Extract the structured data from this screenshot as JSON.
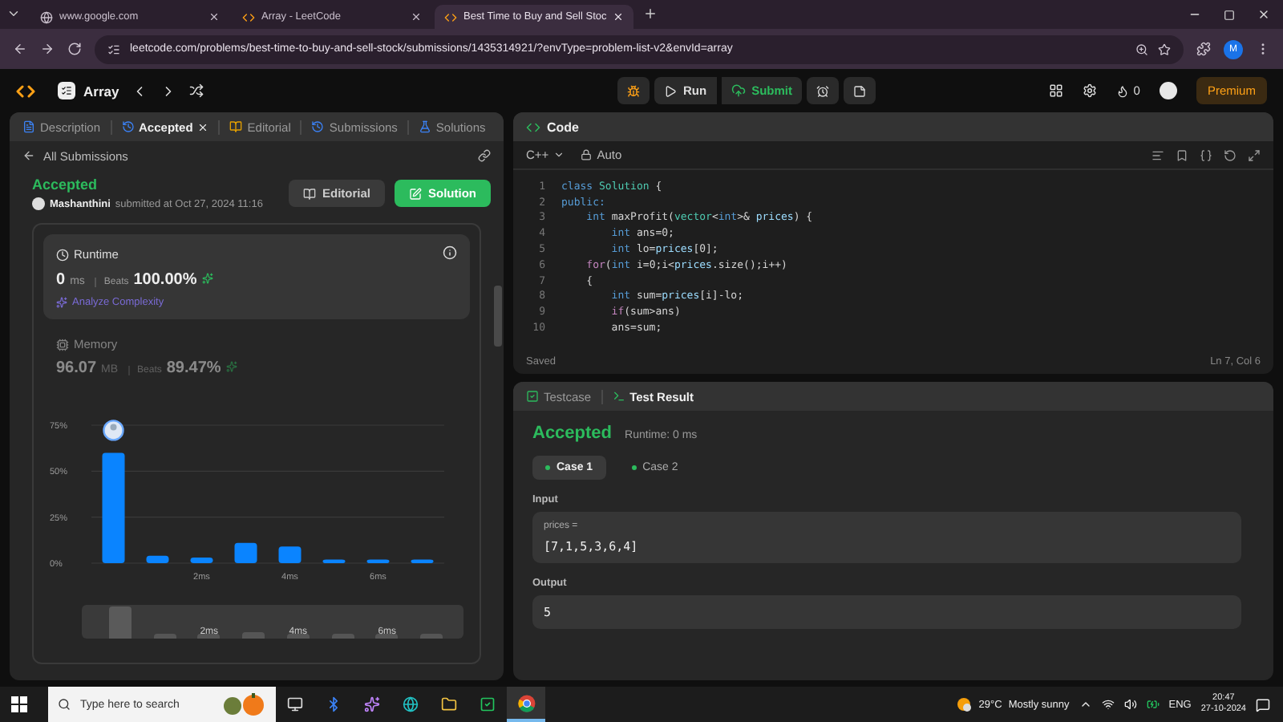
{
  "browser": {
    "tabs": [
      {
        "title": "www.google.com",
        "selected": false
      },
      {
        "title": "Array - LeetCode",
        "selected": false
      },
      {
        "title": "Best Time to Buy and Sell Stoc",
        "selected": true
      }
    ],
    "url": "leetcode.com/problems/best-time-to-buy-and-sell-stock/submissions/1435314921/?envType=problem-list-v2&envId=array",
    "profile_initial": "M"
  },
  "topbar": {
    "problem_list": "Array",
    "run": "Run",
    "submit": "Submit",
    "streak": "0",
    "premium": "Premium"
  },
  "left_panel": {
    "tabs": [
      {
        "label": "Description",
        "selected": false
      },
      {
        "label": "Accepted",
        "selected": true
      },
      {
        "label": "Editorial",
        "selected": false
      },
      {
        "label": "Submissions",
        "selected": false
      },
      {
        "label": "Solutions",
        "selected": false
      }
    ],
    "back_link": "All Submissions",
    "status": "Accepted",
    "user": "Mashanthini",
    "submitted": "submitted at Oct 27, 2024 11:16",
    "buttons": {
      "editorial": "Editorial",
      "solution": "Solution"
    },
    "metrics": [
      {
        "label": "Runtime",
        "value": "0",
        "unit": "ms",
        "beats_label": "Beats",
        "beats": "100.00%",
        "link": "Analyze Complexity",
        "selected": true
      },
      {
        "label": "Memory",
        "value": "96.07",
        "unit": "MB",
        "beats_label": "Beats",
        "beats": "89.47%",
        "selected": false
      }
    ],
    "chart_data": {
      "type": "bar",
      "x": [
        0,
        1,
        2,
        3,
        4,
        5,
        6,
        7
      ],
      "values": [
        60,
        4,
        3,
        11,
        9,
        2,
        2,
        2
      ],
      "xticks": [
        {
          "value": 2,
          "label": "2ms"
        },
        {
          "value": 4,
          "label": "4ms"
        },
        {
          "value": 6,
          "label": "6ms"
        }
      ],
      "yticks": [
        {
          "value": 0,
          "label": "0%"
        },
        {
          "value": 25,
          "label": "25%"
        },
        {
          "value": 50,
          "label": "50%"
        },
        {
          "value": 75,
          "label": "75%"
        }
      ],
      "xlim": [
        -0.5,
        7.5
      ],
      "ylim": [
        0,
        75
      ]
    },
    "range_labels": [
      "2ms",
      "4ms",
      "6ms"
    ]
  },
  "code_panel": {
    "title": "Code",
    "language": "C++",
    "mode": "Auto",
    "lines": [
      {
        "num": "1",
        "tokens": [
          {
            "text": "class",
            "kind": "keyword"
          },
          {
            "text": " Solution",
            "kind": "type"
          },
          {
            "text": " {",
            "kind": "plain"
          }
        ]
      },
      {
        "num": "2",
        "tokens": [
          {
            "text": "public:",
            "kind": "keyword"
          }
        ]
      },
      {
        "num": "3",
        "tokens": [
          {
            "text": "    int",
            "kind": "keyword"
          },
          {
            "text": " maxProfit(",
            "kind": "plain"
          },
          {
            "text": "vector",
            "kind": "type"
          },
          {
            "text": "<",
            "kind": "plain"
          },
          {
            "text": "int",
            "kind": "keyword"
          },
          {
            "text": ">& ",
            "kind": "plain"
          },
          {
            "text": "prices",
            "kind": "variable"
          },
          {
            "text": ") {",
            "kind": "plain"
          }
        ]
      },
      {
        "num": "4",
        "tokens": [
          {
            "text": "        int",
            "kind": "keyword"
          },
          {
            "text": " ans=0;",
            "kind": "plain"
          }
        ]
      },
      {
        "num": "5",
        "tokens": [
          {
            "text": "        int",
            "kind": "keyword"
          },
          {
            "text": " lo=",
            "kind": "plain"
          },
          {
            "text": "prices",
            "kind": "variable"
          },
          {
            "text": "[0];",
            "kind": "plain"
          }
        ]
      },
      {
        "num": "6",
        "tokens": [
          {
            "text": "    for",
            "kind": "control"
          },
          {
            "text": "(",
            "kind": "plain"
          },
          {
            "text": "int",
            "kind": "keyword"
          },
          {
            "text": " i=0;i<",
            "kind": "plain"
          },
          {
            "text": "prices",
            "kind": "variable"
          },
          {
            "text": ".size();i++)",
            "kind": "plain"
          }
        ]
      },
      {
        "num": "7",
        "tokens": [
          {
            "text": "    {",
            "kind": "plain"
          }
        ]
      },
      {
        "num": "8",
        "tokens": [
          {
            "text": "        int",
            "kind": "keyword"
          },
          {
            "text": " sum=",
            "kind": "plain"
          },
          {
            "text": "prices",
            "kind": "variable"
          },
          {
            "text": "[i]-lo;",
            "kind": "plain"
          }
        ]
      },
      {
        "num": "9",
        "tokens": [
          {
            "text": "        if",
            "kind": "control"
          },
          {
            "text": "(sum>ans)",
            "kind": "plain"
          }
        ]
      },
      {
        "num": "10",
        "tokens": [
          {
            "text": "        ans=sum;",
            "kind": "plain"
          }
        ]
      }
    ],
    "saved": "Saved",
    "cursor": "Ln 7, Col 6"
  },
  "test_panel": {
    "tabs": [
      {
        "label": "Testcase",
        "selected": false
      },
      {
        "label": "Test Result",
        "selected": true
      }
    ],
    "status": "Accepted",
    "runtime": "Runtime: 0 ms",
    "cases": [
      {
        "label": "Case 1",
        "selected": true
      },
      {
        "label": "Case 2",
        "selected": false
      }
    ],
    "input_label": "Input",
    "param": "prices =",
    "param_value": "[7,1,5,3,6,4]",
    "output_label": "Output",
    "output": "5"
  },
  "taskbar": {
    "search_placeholder": "Type here to search",
    "temperature": "29°C",
    "weather": "Mostly sunny",
    "language": "ENG",
    "time": "20:47",
    "date": "27-10-2024"
  }
}
